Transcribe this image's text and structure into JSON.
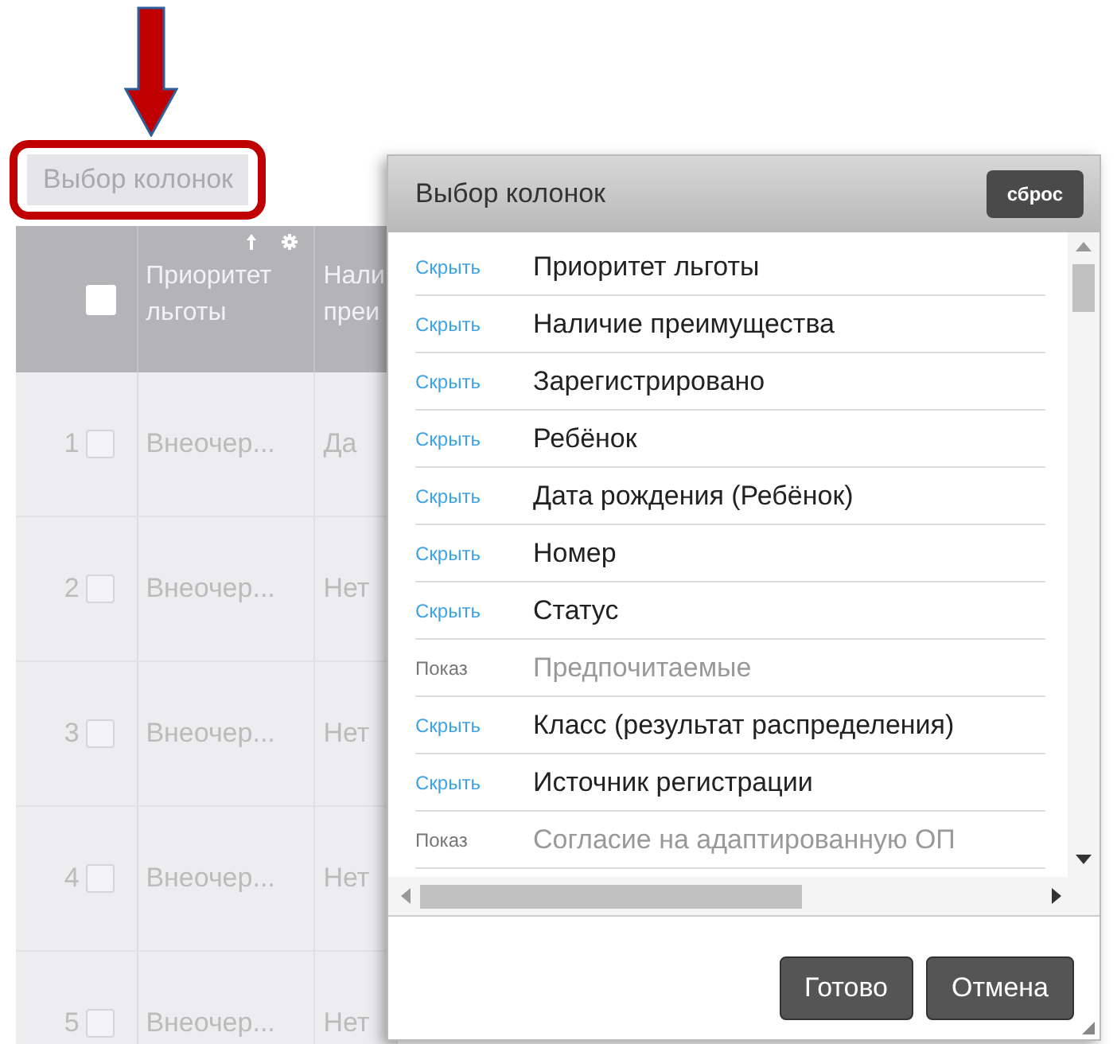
{
  "toolbar": {
    "button": "Выбор колонок"
  },
  "table": {
    "header_checkbox": {
      "checked": false
    },
    "columns": [
      {
        "label": "Приоритет льготы"
      },
      {
        "label": "Нали преи"
      }
    ],
    "rows": [
      {
        "number": "1",
        "checked": false,
        "cells": [
          "Внеочер...",
          "Да"
        ]
      },
      {
        "number": "2",
        "checked": false,
        "cells": [
          "Внеочер...",
          "Нет"
        ]
      },
      {
        "number": "3",
        "checked": false,
        "cells": [
          "Внеочер...",
          "Нет"
        ]
      },
      {
        "number": "4",
        "checked": false,
        "cells": [
          "Внеочер...",
          "Нет"
        ]
      },
      {
        "number": "5",
        "checked": false,
        "cells": [
          "Внеочер...",
          "Нет"
        ]
      }
    ]
  },
  "dialog": {
    "title": "Выбор колонок",
    "reset_button": "сброс",
    "items": [
      {
        "action": "Скрыть",
        "label": "Приоритет льготы",
        "visible": true
      },
      {
        "action": "Скрыть",
        "label": "Наличие преимущества",
        "visible": true
      },
      {
        "action": "Скрыть",
        "label": "Зарегистрировано",
        "visible": true
      },
      {
        "action": "Скрыть",
        "label": "Ребёнок",
        "visible": true
      },
      {
        "action": "Скрыть",
        "label": "Дата рождения (Ребёнок)",
        "visible": true
      },
      {
        "action": "Скрыть",
        "label": "Номер",
        "visible": true
      },
      {
        "action": "Скрыть",
        "label": "Статус",
        "visible": true
      },
      {
        "action": "Показ",
        "label": "Предпочитаемые",
        "visible": false
      },
      {
        "action": "Скрыть",
        "label": "Класс (результат распределения)",
        "visible": true
      },
      {
        "action": "Скрыть",
        "label": "Источник регистрации",
        "visible": true
      },
      {
        "action": "Показ",
        "label": "Согласие на адаптированную ОП",
        "visible": false
      }
    ],
    "buttons": [
      "Готово",
      "Отмена"
    ]
  }
}
